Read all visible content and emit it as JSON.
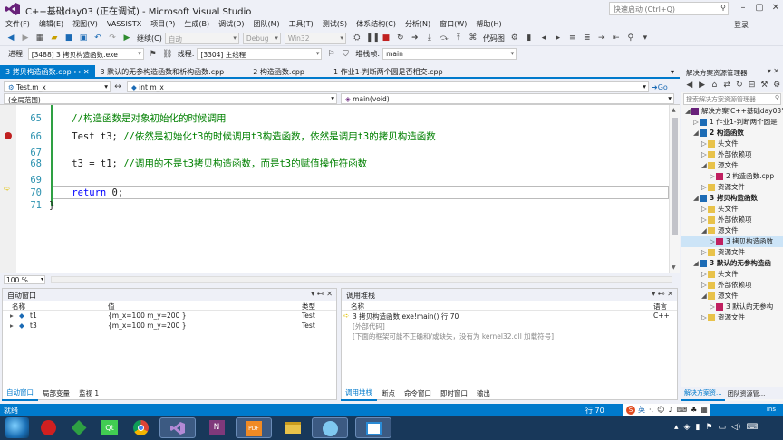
{
  "window": {
    "title": "C++基础day03 (正在调试) - Microsoft Visual Studio",
    "quick_launch_placeholder": "快速启动 (Ctrl+Q)",
    "login": "登录"
  },
  "menu": [
    "文件(F)",
    "编辑(E)",
    "视图(V)",
    "VASSISTX",
    "项目(P)",
    "生成(B)",
    "调试(D)",
    "团队(M)",
    "工具(T)",
    "测试(S)",
    "体系结构(C)",
    "分析(N)",
    "窗口(W)",
    "帮助(H)"
  ],
  "toolbar1": {
    "continue": "继续(C)",
    "auto_combo": "自动",
    "config_combo": "Debug",
    "platform_combo": "Win32",
    "code_map": "代码图"
  },
  "toolbar2": {
    "process_label": "进程:",
    "process_value": "[3488] 3 拷贝构造函数.exe",
    "thread_label": "线程:",
    "thread_value": "[3304] 主线程",
    "stack_label": "堆栈帧:",
    "stack_value": "main"
  },
  "doc_tabs": [
    "3 拷贝构造函数.cpp",
    "3 默认的无参构造函数和析构函数.cpp",
    "2 构造函数.cpp",
    "1 作业1-判断两个圆是否相交.cpp"
  ],
  "nav": {
    "file_combo": "Test.m_x",
    "member_combo": "int m_x",
    "go": "Go",
    "scope_combo": "(全局范围)",
    "func_combo": "main(void)"
  },
  "code": [
    {
      "num": "65",
      "parts": [
        {
          "t": "    ",
          "c": ""
        },
        {
          "t": "//构造函数是对象初始化的时候调用",
          "c": "cmt"
        }
      ]
    },
    {
      "num": "66",
      "parts": [
        {
          "t": "    Test t3; ",
          "c": ""
        },
        {
          "t": "//依然是初始化t3的时候调用t3构造函数，依然是调用t3的拷贝构造函数",
          "c": "cmt"
        }
      ]
    },
    {
      "num": "67",
      "parts": [
        {
          "t": "",
          "c": ""
        }
      ]
    },
    {
      "num": "68",
      "parts": [
        {
          "t": "    t3 = t1; ",
          "c": ""
        },
        {
          "t": "//调用的不是t3拷贝构造函数，而是t3的赋值操作符函数",
          "c": "cmt"
        }
      ]
    },
    {
      "num": "69",
      "parts": [
        {
          "t": "",
          "c": ""
        }
      ]
    },
    {
      "num": "70",
      "parts": [
        {
          "t": "    ",
          "c": ""
        },
        {
          "t": "return",
          "c": "kw"
        },
        {
          "t": " 0;",
          "c": ""
        }
      ]
    },
    {
      "num": "71",
      "parts": [
        {
          "t": "}",
          "c": ""
        }
      ]
    }
  ],
  "zoom": "100 %",
  "autos": {
    "title": "自动窗口",
    "headers": {
      "name": "名称",
      "value": "值",
      "type": "类型"
    },
    "rows": [
      {
        "name": "t1",
        "value": "{m_x=100 m_y=200 }",
        "type": "Test"
      },
      {
        "name": "t3",
        "value": "{m_x=100 m_y=200 }",
        "type": "Test"
      }
    ],
    "tabs": [
      "自动窗口",
      "局部变量",
      "监视 1"
    ]
  },
  "callstack": {
    "title": "调用堆栈",
    "headers": {
      "name": "名称",
      "lang": "语言"
    },
    "rows": [
      {
        "name": "3 拷贝构造函数.exe!main() 行 70",
        "lang": "C++"
      },
      {
        "name": "[外部代码]",
        "lang": ""
      },
      {
        "name": "[下面的框架可能不正确和/或缺失，没有为 kernel32.dll 加载符号]",
        "lang": ""
      }
    ],
    "tabs": [
      "调用堆栈",
      "断点",
      "命令窗口",
      "即时窗口",
      "输出"
    ]
  },
  "solution_explorer": {
    "title": "解决方案资源管理器",
    "search_placeholder": "搜索解决方案资源管理器",
    "items": [
      {
        "label": "解决方案'C++基础day03'",
        "indent": 0
      },
      {
        "label": "1 作业1-判断两个圆是",
        "indent": 1
      },
      {
        "label": "2 构造函数",
        "indent": 1
      },
      {
        "label": "头文件",
        "indent": 2
      },
      {
        "label": "外部依赖项",
        "indent": 2
      },
      {
        "label": "源文件",
        "indent": 2
      },
      {
        "label": "2 构造函数.cpp",
        "indent": 3
      },
      {
        "label": "资源文件",
        "indent": 2
      },
      {
        "label": "3 拷贝构造函数",
        "indent": 1
      },
      {
        "label": "头文件",
        "indent": 2
      },
      {
        "label": "外部依赖项",
        "indent": 2
      },
      {
        "label": "源文件",
        "indent": 2
      },
      {
        "label": "3 拷贝构造函数",
        "indent": 3
      },
      {
        "label": "资源文件",
        "indent": 2
      },
      {
        "label": "3 默认的无参构造函",
        "indent": 1
      },
      {
        "label": "头文件",
        "indent": 2
      },
      {
        "label": "外部依赖项",
        "indent": 2
      },
      {
        "label": "源文件",
        "indent": 2
      },
      {
        "label": "3 默认的无参构",
        "indent": 3
      },
      {
        "label": "资源文件",
        "indent": 2
      }
    ],
    "tabs": [
      "解决方案资...",
      "团队资源管..."
    ]
  },
  "status": {
    "left": "就绪",
    "line": "行 70"
  },
  "ime": "英",
  "colors": {
    "accent": "#007acc",
    "taskbar": "#18385a"
  }
}
